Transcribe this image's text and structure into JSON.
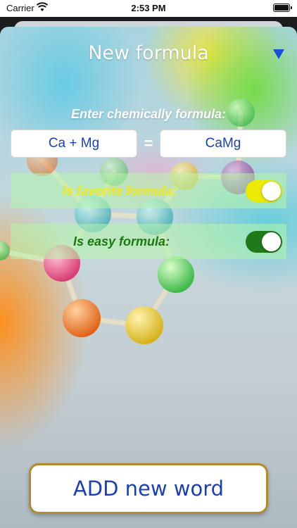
{
  "status_bar": {
    "carrier": "Carrier",
    "time": "2:53 PM",
    "icons": [
      "wifi-icon",
      "battery-icon"
    ]
  },
  "header": {
    "title": "New formula",
    "menu_icon": "triangle-down-icon",
    "menu_color": "#1a4fd6"
  },
  "form": {
    "prompt": "Enter chemically formula:",
    "left_value": "Ca + Mg",
    "equals": "=",
    "right_value": "CaMg"
  },
  "options": {
    "favorite": {
      "label": "Is favorite formula:",
      "on": true,
      "color": "#ecea00"
    },
    "easy": {
      "label": "Is easy formula:",
      "on": true,
      "color": "#1f7a1a"
    }
  },
  "footer": {
    "add_label": "ADD new word"
  }
}
